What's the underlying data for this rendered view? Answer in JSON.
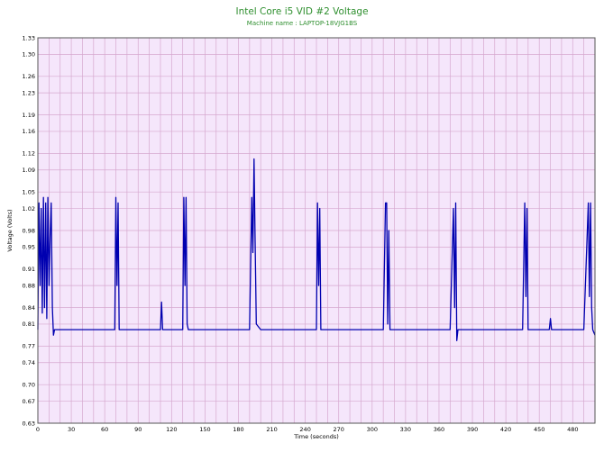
{
  "chart_data": {
    "type": "line",
    "title": "Intel Core i5 VID #2 Voltage",
    "subtitle": "Machine name : LAPTOP-18VJG1BS",
    "xlabel": "Time (seconds)",
    "ylabel": "Voltage (Volts)",
    "xlim": [
      0,
      500
    ],
    "ylim": [
      0.63,
      1.33
    ],
    "x_ticks": [
      "0",
      "30",
      "60",
      "90",
      "120",
      "150",
      "180",
      "210",
      "240",
      "270",
      "300",
      "330",
      "360",
      "390",
      "420",
      "450",
      "480"
    ],
    "y_ticks": [
      "0.63",
      "0.67",
      "0.70",
      "0.74",
      "0.77",
      "0.81",
      "0.84",
      "0.88",
      "0.91",
      "0.95",
      "0.98",
      "1.02",
      "1.05",
      "1.09",
      "1.12",
      "1.16",
      "1.19",
      "1.23",
      "1.26",
      "1.30",
      "1.33"
    ],
    "grid": true,
    "colors": {
      "plot_background": "#f5e6fb",
      "grid": "#d6a8cf",
      "line": "#0000b0",
      "title": "#2f8f2f"
    },
    "series": [
      {
        "values": [
          [
            0,
            0.8
          ],
          [
            1,
            1.03
          ],
          [
            2,
            0.88
          ],
          [
            3,
            1.02
          ],
          [
            4,
            0.83
          ],
          [
            5,
            1.04
          ],
          [
            6,
            0.84
          ],
          [
            7,
            1.03
          ],
          [
            8,
            0.82
          ],
          [
            9,
            1.04
          ],
          [
            10,
            0.88
          ],
          [
            11,
            0.97
          ],
          [
            12,
            1.03
          ],
          [
            13,
            0.84
          ],
          [
            14,
            0.79
          ],
          [
            15,
            0.8
          ],
          [
            20,
            0.8
          ],
          [
            25,
            0.8
          ],
          [
            30,
            0.8
          ],
          [
            35,
            0.8
          ],
          [
            40,
            0.8
          ],
          [
            45,
            0.8
          ],
          [
            50,
            0.8
          ],
          [
            55,
            0.8
          ],
          [
            60,
            0.8
          ],
          [
            65,
            0.8
          ],
          [
            69,
            0.8
          ],
          [
            70,
            1.04
          ],
          [
            71,
            0.88
          ],
          [
            72,
            1.03
          ],
          [
            73,
            0.8
          ],
          [
            75,
            0.8
          ],
          [
            80,
            0.8
          ],
          [
            85,
            0.8
          ],
          [
            90,
            0.8
          ],
          [
            95,
            0.8
          ],
          [
            100,
            0.8
          ],
          [
            105,
            0.8
          ],
          [
            110,
            0.8
          ],
          [
            111,
            0.85
          ],
          [
            112,
            0.8
          ],
          [
            115,
            0.8
          ],
          [
            120,
            0.8
          ],
          [
            125,
            0.8
          ],
          [
            130,
            0.8
          ],
          [
            131,
            1.04
          ],
          [
            132,
            0.88
          ],
          [
            133,
            1.04
          ],
          [
            134,
            0.81
          ],
          [
            135,
            0.8
          ],
          [
            140,
            0.8
          ],
          [
            145,
            0.8
          ],
          [
            150,
            0.8
          ],
          [
            155,
            0.8
          ],
          [
            160,
            0.8
          ],
          [
            165,
            0.8
          ],
          [
            170,
            0.8
          ],
          [
            175,
            0.8
          ],
          [
            180,
            0.8
          ],
          [
            185,
            0.8
          ],
          [
            190,
            0.8
          ],
          [
            192,
            1.04
          ],
          [
            193,
            0.94
          ],
          [
            194,
            1.11
          ],
          [
            195,
            0.96
          ],
          [
            196,
            0.81
          ],
          [
            200,
            0.8
          ],
          [
            205,
            0.8
          ],
          [
            210,
            0.8
          ],
          [
            215,
            0.8
          ],
          [
            220,
            0.8
          ],
          [
            225,
            0.8
          ],
          [
            230,
            0.8
          ],
          [
            235,
            0.8
          ],
          [
            240,
            0.8
          ],
          [
            245,
            0.8
          ],
          [
            250,
            0.8
          ],
          [
            251,
            1.03
          ],
          [
            252,
            0.88
          ],
          [
            253,
            1.02
          ],
          [
            254,
            0.8
          ],
          [
            255,
            0.8
          ],
          [
            260,
            0.8
          ],
          [
            265,
            0.8
          ],
          [
            270,
            0.8
          ],
          [
            275,
            0.8
          ],
          [
            280,
            0.8
          ],
          [
            285,
            0.8
          ],
          [
            290,
            0.8
          ],
          [
            295,
            0.8
          ],
          [
            300,
            0.8
          ],
          [
            305,
            0.8
          ],
          [
            310,
            0.8
          ],
          [
            312,
            1.03
          ],
          [
            313,
            1.03
          ],
          [
            314,
            0.81
          ],
          [
            315,
            0.98
          ],
          [
            316,
            0.8
          ],
          [
            320,
            0.8
          ],
          [
            325,
            0.8
          ],
          [
            330,
            0.8
          ],
          [
            335,
            0.8
          ],
          [
            340,
            0.8
          ],
          [
            345,
            0.8
          ],
          [
            350,
            0.8
          ],
          [
            355,
            0.8
          ],
          [
            360,
            0.8
          ],
          [
            365,
            0.8
          ],
          [
            370,
            0.8
          ],
          [
            373,
            1.02
          ],
          [
            374,
            0.84
          ],
          [
            375,
            1.03
          ],
          [
            376,
            0.78
          ],
          [
            377,
            0.8
          ],
          [
            380,
            0.8
          ],
          [
            385,
            0.8
          ],
          [
            390,
            0.8
          ],
          [
            395,
            0.8
          ],
          [
            400,
            0.8
          ],
          [
            405,
            0.8
          ],
          [
            410,
            0.8
          ],
          [
            415,
            0.8
          ],
          [
            420,
            0.8
          ],
          [
            425,
            0.8
          ],
          [
            430,
            0.8
          ],
          [
            435,
            0.8
          ],
          [
            437,
            1.03
          ],
          [
            438,
            0.86
          ],
          [
            439,
            1.02
          ],
          [
            440,
            0.8
          ],
          [
            445,
            0.8
          ],
          [
            450,
            0.8
          ],
          [
            455,
            0.8
          ],
          [
            459,
            0.8
          ],
          [
            460,
            0.82
          ],
          [
            461,
            0.8
          ],
          [
            465,
            0.8
          ],
          [
            470,
            0.8
          ],
          [
            475,
            0.8
          ],
          [
            480,
            0.8
          ],
          [
            485,
            0.8
          ],
          [
            490,
            0.8
          ],
          [
            494,
            1.03
          ],
          [
            495,
            0.86
          ],
          [
            496,
            1.03
          ],
          [
            497,
            0.84
          ],
          [
            498,
            0.8
          ],
          [
            500,
            0.79
          ]
        ]
      }
    ]
  }
}
